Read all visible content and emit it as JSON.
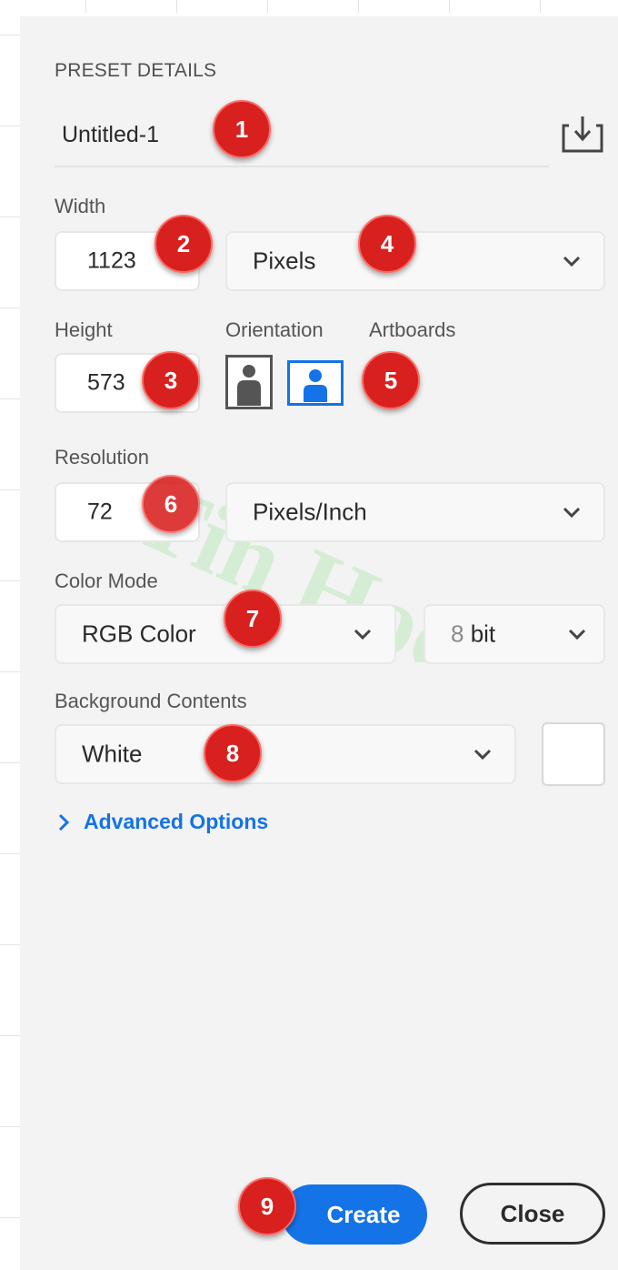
{
  "panel": {
    "section_title": "PRESET DETAILS",
    "document_name": "Untitled-1"
  },
  "width": {
    "label": "Width",
    "value": "1123",
    "unit": "Pixels"
  },
  "height": {
    "label": "Height",
    "value": "573"
  },
  "orientation": {
    "label": "Orientation",
    "selected": "landscape"
  },
  "artboards": {
    "label": "Artboards"
  },
  "resolution": {
    "label": "Resolution",
    "value": "72",
    "unit": "Pixels/Inch"
  },
  "color_mode": {
    "label": "Color Mode",
    "mode": "RGB Color",
    "bit_prefix": "8",
    "bit_suffix": " bit"
  },
  "background": {
    "label": "Background Contents",
    "value": "White",
    "swatch_color": "#ffffff"
  },
  "advanced": {
    "label": "Advanced Options"
  },
  "buttons": {
    "create": "Create",
    "close": "Close"
  },
  "badges": [
    "1",
    "2",
    "3",
    "4",
    "5",
    "6",
    "7",
    "8",
    "9"
  ],
  "watermark": {
    "text": "Tin Học Sa"
  },
  "colors": {
    "accent": "#1473e6",
    "badge": "#d8201f",
    "panel_bg": "#f3f3f3"
  }
}
